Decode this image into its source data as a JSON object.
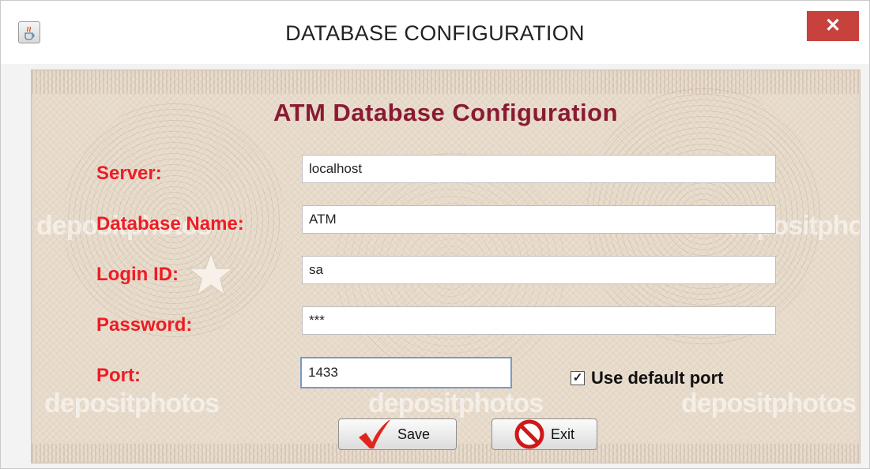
{
  "window": {
    "title": "DATABASE CONFIGURATION",
    "close_glyph": "✕"
  },
  "form": {
    "heading": "ATM Database Configuration",
    "server": {
      "label": "Server:",
      "value": "localhost"
    },
    "database": {
      "label": "Database Name:",
      "value": "ATM"
    },
    "login": {
      "label": "Login ID:",
      "value": "sa"
    },
    "password": {
      "label": "Password:",
      "value": "***"
    },
    "port": {
      "label": "Port:",
      "value": "1433"
    },
    "default_port": {
      "label": "Use default port",
      "checked": true,
      "glyph": "✓"
    }
  },
  "buttons": {
    "save": "Save",
    "exit": "Exit"
  },
  "watermark": {
    "text": "depositphotos"
  },
  "icons": {
    "app": "java-cup-icon",
    "close": "close-icon",
    "save": "checkmark-icon",
    "exit": "no-sign-icon"
  },
  "colors": {
    "label": "#ee1c24",
    "heading": "#8a1a32",
    "close": "#c7413d",
    "accent_check": "#e0251c",
    "exit_icon": "#d01818"
  }
}
